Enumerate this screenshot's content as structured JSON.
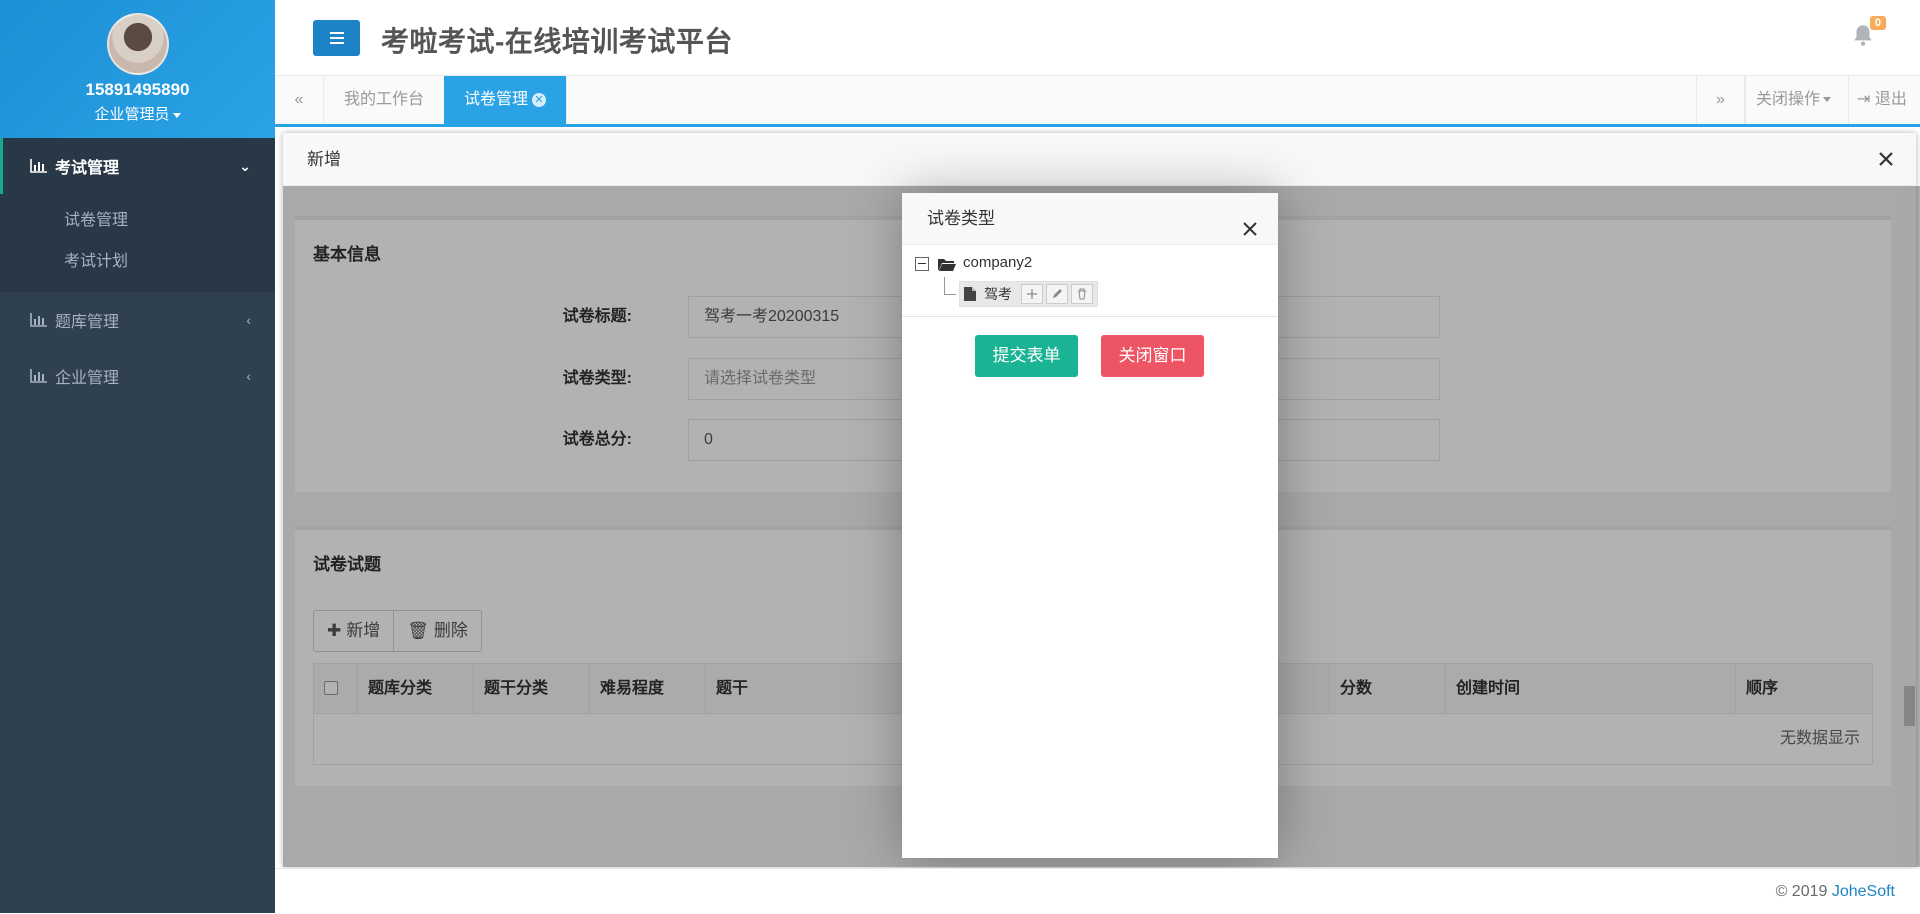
{
  "sidebar": {
    "user_phone": "15891495890",
    "user_role": "企业管理员",
    "menu": [
      {
        "label": "考试管理",
        "expanded": true,
        "children": [
          "试卷管理",
          "考试计划"
        ]
      },
      {
        "label": "题库管理",
        "expanded": false
      },
      {
        "label": "企业管理",
        "expanded": false
      }
    ]
  },
  "header": {
    "title": "考啦考试-在线培训考试平台",
    "notification_count": "0"
  },
  "tabs": {
    "items": [
      "我的工作台",
      "试卷管理"
    ],
    "active_index": 1,
    "close_ops": "关闭操作",
    "logout": "退出"
  },
  "layer": {
    "title": "新增",
    "basic_info": {
      "title": "基本信息",
      "fields": [
        {
          "label": "试卷标题:",
          "value": "驾考一考20200315",
          "placeholder": ""
        },
        {
          "label": "试卷类型:",
          "value": "",
          "placeholder": "请选择试卷类型"
        },
        {
          "label": "试卷总分:",
          "value": "0",
          "placeholder": ""
        }
      ]
    },
    "questions": {
      "title": "试卷试题",
      "add_label": "新增",
      "delete_label": "删除",
      "columns": [
        "题库分类",
        "题干分类",
        "难易程度",
        "题干",
        "分数",
        "创建时间",
        "顺序"
      ],
      "empty_text": "无数据显示"
    }
  },
  "dialog": {
    "title": "试卷类型",
    "tree_root": "company2",
    "tree_child": "驾考",
    "submit_label": "提交表单",
    "close_label": "关闭窗口"
  },
  "footer": {
    "copyright": "© 2019 ",
    "brand": "JoheSoft"
  },
  "colors": {
    "sidebar_bg": "#2f4050",
    "primary": "#1c84c6",
    "tab_active": "#2aa3e6",
    "success": "#1ab394",
    "danger": "#ed5565",
    "badge": "#f8ac59"
  }
}
